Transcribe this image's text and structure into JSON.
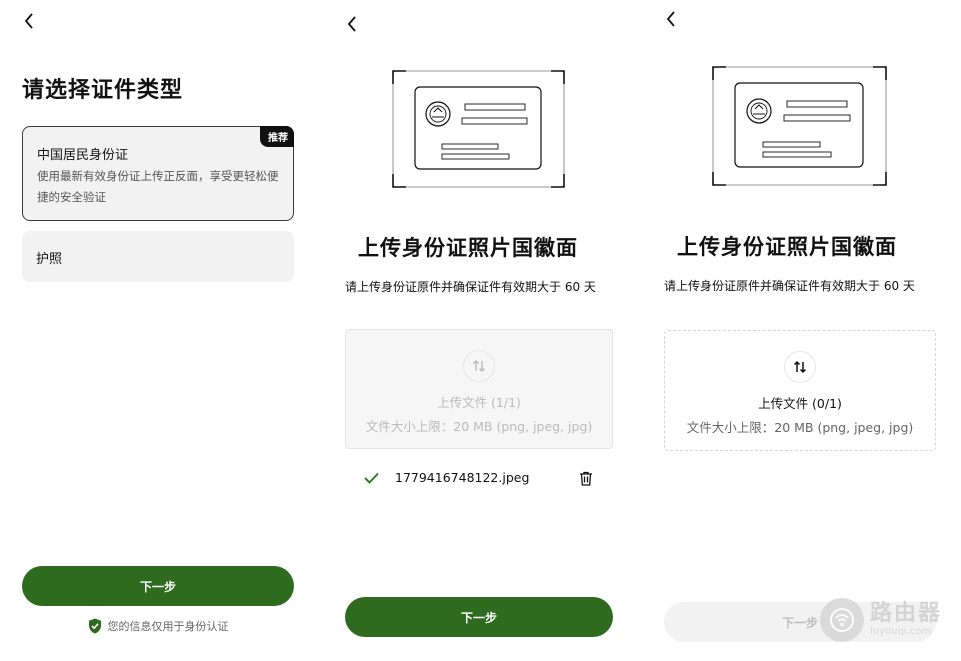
{
  "screen1": {
    "title": "请选择证件类型",
    "options": [
      {
        "name": "中国居民身份证",
        "desc": "使用最新有效身份证上传正反面，享受更轻松便捷的安全验证",
        "badge": "推荐"
      },
      {
        "name": "护照"
      }
    ],
    "next_label": "下一步",
    "privacy_text": "您的信息仅用于身份认证"
  },
  "screen2": {
    "heading": "上传身份证照片国徽面",
    "desc": "请上传身份证原件并确保证件有效期大于 60 天",
    "upload_title": "上传文件 (1/1)",
    "upload_limit": "文件大小上限：20 MB (png, jpeg, jpg)",
    "file_name": "1779416748122.jpeg",
    "next_label": "下一步"
  },
  "screen3": {
    "heading": "上传身份证照片国徽面",
    "desc": "请上传身份证原件并确保证件有效期大于 60 天",
    "upload_title": "上传文件 (0/1)",
    "upload_limit": "文件大小上限：20 MB (png, jpeg, jpg)",
    "next_label": "下一步"
  },
  "watermark": {
    "line1": "路由器",
    "line2": "luyouqi.com"
  },
  "colors": {
    "primary": "#2e6b1e",
    "check": "#2e7d1e",
    "disabled": "#f2f2f2"
  }
}
